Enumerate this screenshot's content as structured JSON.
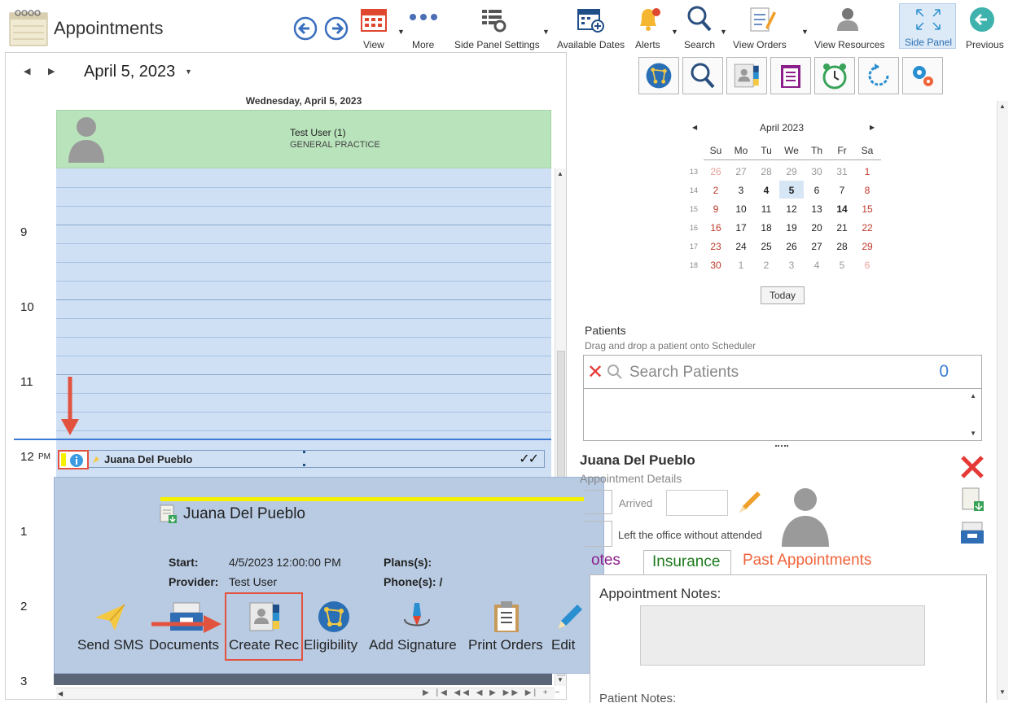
{
  "app": {
    "title": "Appointments"
  },
  "toolbar": {
    "buttons": [
      {
        "label": "View",
        "icon": "calendar-icon"
      },
      {
        "label": "More",
        "icon": "more-dots-icon"
      },
      {
        "label": "Side Panel Settings",
        "icon": "side-panel-settings-icon"
      },
      {
        "label": "Available Dates",
        "icon": "available-dates-icon"
      },
      {
        "label": "Alerts",
        "icon": "bell-icon"
      },
      {
        "label": "Search",
        "icon": "search-icon"
      },
      {
        "label": "View Orders",
        "icon": "orders-icon"
      },
      {
        "label": "View Resources",
        "icon": "resources-icon"
      },
      {
        "label": "Side Panel",
        "icon": "expand-icon"
      },
      {
        "label": "Previous",
        "icon": "previous-icon"
      }
    ]
  },
  "scheduler": {
    "date": "April 5, 2023",
    "day_header": "Wednesday, April 5, 2023",
    "resource_name": "Test User (1)",
    "resource_specialty": "GENERAL PRACTICE",
    "hours": [
      "9",
      "10",
      "11",
      "12",
      "PM",
      "1",
      "2",
      "3"
    ],
    "appointment": {
      "patient": "Juana Del Pueblo",
      "checks": "✓✓"
    }
  },
  "popup": {
    "patient": "Juana Del Pueblo",
    "start_label": "Start:",
    "start_value": "4/5/2023 12:00:00 PM",
    "provider_label": "Provider:",
    "provider_value": "Test User",
    "plans_label": "Plans(s):",
    "phone_label": "Phone(s): /",
    "actions": [
      {
        "label": "Send SMS",
        "icon": "send-sms-icon"
      },
      {
        "label": "Documents",
        "icon": "documents-icon"
      },
      {
        "label": "Create Rec",
        "icon": "create-record-icon"
      },
      {
        "label": "Eligibility",
        "icon": "eligibility-icon"
      },
      {
        "label": "Add Signature",
        "icon": "signature-icon"
      },
      {
        "label": "Print Orders",
        "icon": "print-orders-icon"
      },
      {
        "label": "Edit",
        "icon": "edit-pencil-icon"
      }
    ]
  },
  "mini_calendar": {
    "month": "April 2023",
    "dow": [
      "Su",
      "Mo",
      "Tu",
      "We",
      "Th",
      "Fr",
      "Sa"
    ],
    "weeks": [
      {
        "num": "13",
        "days": [
          "26",
          "27",
          "28",
          "29",
          "30",
          "31",
          "1"
        ]
      },
      {
        "num": "14",
        "days": [
          "2",
          "3",
          "4",
          "5",
          "6",
          "7",
          "8"
        ]
      },
      {
        "num": "15",
        "days": [
          "9",
          "10",
          "11",
          "12",
          "13",
          "14",
          "15"
        ]
      },
      {
        "num": "16",
        "days": [
          "16",
          "17",
          "18",
          "19",
          "20",
          "21",
          "22"
        ]
      },
      {
        "num": "17",
        "days": [
          "23",
          "24",
          "25",
          "26",
          "27",
          "28",
          "29"
        ]
      },
      {
        "num": "18",
        "days": [
          "30",
          "1",
          "2",
          "3",
          "4",
          "5",
          "6"
        ]
      }
    ],
    "selected_day": "5",
    "today_button": "Today"
  },
  "patients": {
    "label": "Patients",
    "hint": "Drag and drop a patient onto Scheduler",
    "search_placeholder": "Search Patients",
    "count": "0"
  },
  "details": {
    "patient_name": "Juana Del Pueblo",
    "subtitle": "Appointment Details",
    "arrived_label": "Arrived",
    "left_office_label": "Left the office without attended",
    "tabs": {
      "notes": "otes",
      "insurance": "Insurance",
      "past": "Past Appointments"
    },
    "appointment_notes_label": "Appointment Notes:",
    "patient_notes_label": "Patient Notes:"
  },
  "colors": {
    "accent": "#3a7bd5",
    "resource_header": "#b9e3bb",
    "grid": "#cfe0f5",
    "popup": "#b8cbe3",
    "highlight_red": "#e2533f"
  }
}
